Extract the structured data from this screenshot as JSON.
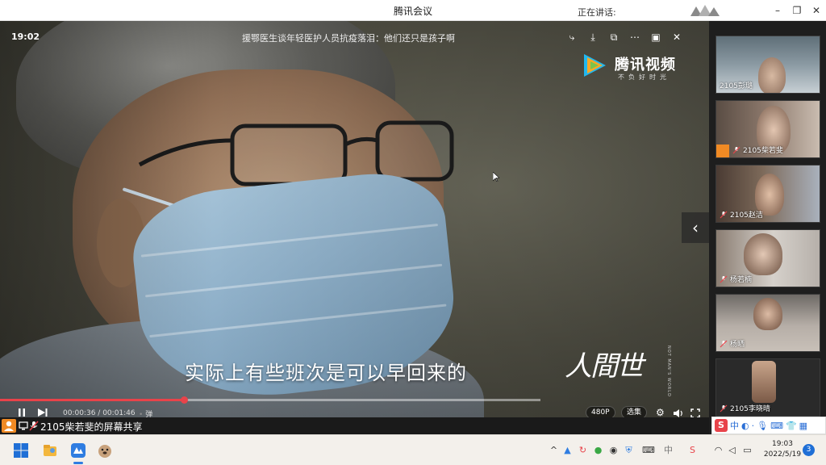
{
  "window": {
    "title": "腾讯会议",
    "speaking_label": "正在讲话:",
    "controls": {
      "minimize": "–",
      "restore": "❐",
      "close": "✕"
    }
  },
  "video": {
    "clock": "19:02",
    "title": "援鄂医生谈年轻医护人员抗疫落泪：他们还只是孩子啊",
    "subtitle": "实际上有些班次是可以早回来的",
    "brand": {
      "name": "腾讯视频",
      "slogan": "不负好时光"
    },
    "show_logo": {
      "main": "人間世",
      "sub": "NOT MAN'S WORLD"
    },
    "player": {
      "current_time": "00:00:36",
      "duration": "00:01:46",
      "progress_fraction": 0.34,
      "buffered_fraction": 1.0,
      "danmu_label": "弹",
      "quality": "480P",
      "episodes": "选集"
    },
    "top_icons": [
      "share-icon",
      "download-icon",
      "popout-icon",
      "more-icon",
      "pip-icon",
      "close-icon"
    ]
  },
  "share_bar": {
    "text": "2105柴若斐的屏幕共享"
  },
  "participants": [
    {
      "name": "2105彭璐",
      "muted": false
    },
    {
      "name": "2105柴若斐",
      "muted": true,
      "sharing": true
    },
    {
      "name": "2105赵洁",
      "muted": true
    },
    {
      "name": "杨若楠",
      "muted": true
    },
    {
      "name": "杨晒",
      "muted": true
    },
    {
      "name": "2105李晓晴",
      "muted": true
    }
  ],
  "ime": {
    "logo": "S",
    "mode": "中"
  },
  "taskbar": {
    "time": "19:03",
    "date": "2022/5/19",
    "notifications": "3"
  },
  "colors": {
    "accent_red": "#e8434a",
    "orange": "#f08a24",
    "panel_bg": "#1e1e1e"
  }
}
